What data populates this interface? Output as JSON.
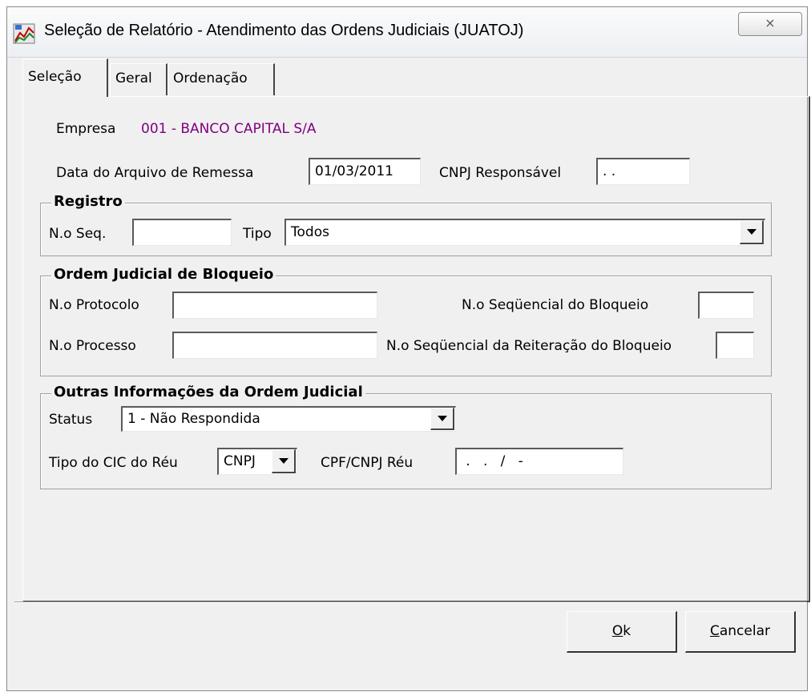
{
  "window": {
    "title": "Seleção de Relatório - Atendimento das Ordens Judiciais (JUATOJ)",
    "close_label": "⨯"
  },
  "tabs": [
    {
      "label": "Seleção"
    },
    {
      "label": "Geral"
    },
    {
      "label": "Ordenação"
    }
  ],
  "empresa": {
    "label": "Empresa",
    "value": "001 - BANCO CAPITAL S/A",
    "color": "#800080"
  },
  "data_arquivo": {
    "label": "Data do Arquivo de Remessa",
    "value": "01/03/2011"
  },
  "cnpj_responsavel": {
    "label": "CNPJ Responsável",
    "value": " .  ."
  },
  "registro": {
    "title": "Registro",
    "nseq_label": "N.o Seq.",
    "nseq_value": "",
    "tipo_label": "Tipo",
    "tipo_value": "Todos"
  },
  "ordem": {
    "title": "Ordem Judicial de Bloqueio",
    "protocolo_label": "N.o Protocolo",
    "protocolo_value": "",
    "seq_bloqueio_label": "N.o Seqüencial do Bloqueio",
    "seq_bloqueio_value": "",
    "processo_label": "N.o Processo",
    "processo_value": "",
    "seq_reiteracao_label": "N.o Seqüencial da Reiteração do Bloqueio",
    "seq_reiteracao_value": ""
  },
  "outras": {
    "title": "Outras Informações da Ordem Judicial",
    "status_label": "Status",
    "status_value": "1 - Não Respondida",
    "tipo_cic_label": "Tipo do CIC do Réu",
    "tipo_cic_value": "CNPJ",
    "cpf_cnpj_label": "CPF/CNPJ Réu",
    "cpf_cnpj_value": " .   .   /   -"
  },
  "buttons": {
    "ok_mnemonic": "O",
    "ok_rest": "k",
    "cancel_mnemonic": "C",
    "cancel_rest": "ancelar"
  }
}
